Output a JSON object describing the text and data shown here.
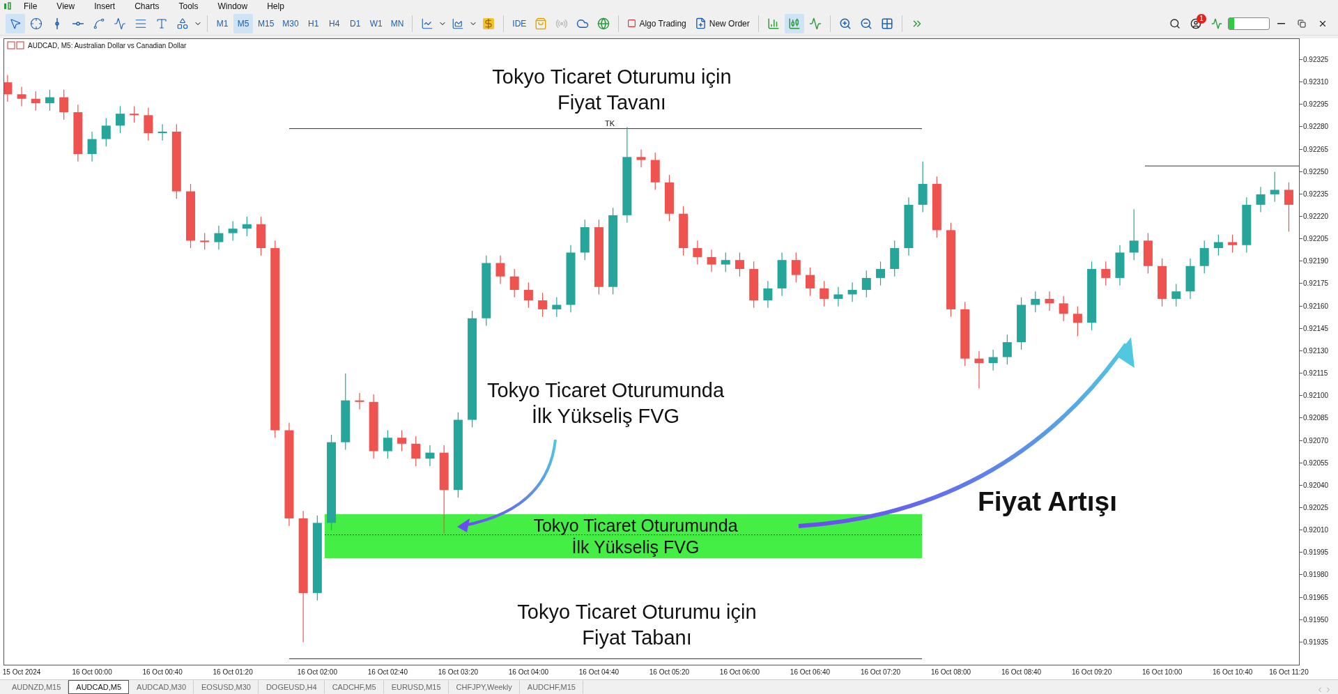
{
  "menu": [
    "File",
    "View",
    "Insert",
    "Charts",
    "Tools",
    "Window",
    "Help"
  ],
  "toolbar": {
    "tools": [
      {
        "kind": "cursor",
        "selected": true
      },
      {
        "kind": "crosshair",
        "selected": false
      },
      {
        "kind": "vline",
        "selected": false
      },
      {
        "kind": "hline",
        "selected": false
      },
      {
        "kind": "trend",
        "selected": false
      },
      {
        "kind": "path",
        "selected": false
      },
      {
        "kind": "channel",
        "selected": false
      },
      {
        "kind": "text",
        "selected": false
      },
      {
        "kind": "shapes",
        "selected": false
      }
    ],
    "timeframes": [
      {
        "label": "M1",
        "selected": false
      },
      {
        "label": "M5",
        "selected": true
      },
      {
        "label": "M15",
        "selected": false
      },
      {
        "label": "M30",
        "selected": false
      },
      {
        "label": "H1",
        "selected": false
      },
      {
        "label": "H4",
        "selected": false
      },
      {
        "label": "D1",
        "selected": false
      },
      {
        "label": "W1",
        "selected": false
      },
      {
        "label": "MN",
        "selected": false
      }
    ],
    "ide_label": "IDE",
    "algo_trading": "Algo Trading",
    "new_order": "New Order",
    "chart_types": [
      {
        "kind": "bars",
        "selected": false
      },
      {
        "kind": "candles",
        "selected": true
      },
      {
        "kind": "line",
        "selected": false
      }
    ],
    "notification_count": "1"
  },
  "chart": {
    "header": "AUDCAD, M5:  Australian Dollar vs Canadian Dollar",
    "level_label": "TK",
    "annotations": [
      {
        "lines": [
          "Tokyo Ticaret Oturumu için",
          "Fiyat Tavanı"
        ]
      },
      {
        "lines": [
          "Tokyo Ticaret Oturumunda",
          "İlk Yükseliş FVG"
        ]
      },
      {
        "lines": [
          "Tokyo Ticaret Oturumu için",
          "Fiyat Tabanı"
        ]
      },
      {
        "lines": [
          "Fiyat Artışı"
        ]
      }
    ],
    "fvg_zone": {
      "lines": [
        "Tokyo Ticaret Oturumunda",
        "İlk Yükseliş FVG"
      ]
    },
    "chart_data": {
      "type": "candlestick",
      "ylim": [
        0.9192,
        0.92339
      ],
      "ref_lines": [
        {
          "axis": "y",
          "value": 0.92279
        },
        {
          "axis": "y",
          "value": 0.92254
        },
        {
          "axis": "y",
          "value": 0.91924
        },
        {
          "axis": "y",
          "value": 0.92007
        }
      ],
      "categories": [
        null,
        "15 Oct 2024",
        null,
        null,
        null,
        null,
        "16 Oct 00:00",
        null,
        null,
        null,
        null,
        "16 Oct 00:40",
        null,
        null,
        null,
        null,
        "16 Oct 01:20",
        null,
        null,
        null,
        null,
        null,
        "16 Oct 02:00",
        null,
        null,
        null,
        null,
        "16 Oct 02:40",
        null,
        null,
        null,
        null,
        "16 Oct 03:20",
        null,
        null,
        null,
        null,
        "16 Oct 04:00",
        null,
        null,
        null,
        null,
        "16 Oct 04:40",
        null,
        null,
        null,
        null,
        "16 Oct 05:20",
        null,
        null,
        null,
        null,
        "16 Oct 06:00",
        null,
        null,
        null,
        null,
        "16 Oct 06:40",
        null,
        null,
        null,
        null,
        "16 Oct 07:20",
        null,
        null,
        null,
        null,
        "16 Oct 08:00",
        null,
        null,
        null,
        null,
        "16 Oct 08:40",
        null,
        null,
        null,
        null,
        "16 Oct 09:20",
        null,
        null,
        null,
        null,
        "16 Oct 10:00",
        null,
        null,
        null,
        null,
        "16 Oct 10:40",
        null,
        null,
        null,
        "16 Oct 11:20"
      ],
      "yticks": [
        {
          "value": 0.92325,
          "label": "0.92325"
        },
        {
          "value": 0.9231,
          "label": "0.92310"
        },
        {
          "value": 0.92295,
          "label": "0.92295"
        },
        {
          "value": 0.9228,
          "label": "0.92280"
        },
        {
          "value": 0.92265,
          "label": "0.92265"
        },
        {
          "value": 0.9225,
          "label": "0.92250"
        },
        {
          "value": 0.92235,
          "label": "0.92235"
        },
        {
          "value": 0.9222,
          "label": "0.92220"
        },
        {
          "value": 0.92205,
          "label": "0.92205"
        },
        {
          "value": 0.9219,
          "label": "0.92190"
        },
        {
          "value": 0.92175,
          "label": "0.92175"
        },
        {
          "value": 0.9216,
          "label": "0.92160"
        },
        {
          "value": 0.92145,
          "label": "0.92145"
        },
        {
          "value": 0.9213,
          "label": "0.92130"
        },
        {
          "value": 0.92115,
          "label": "0.92115"
        },
        {
          "value": 0.921,
          "label": "0.92100"
        },
        {
          "value": 0.92085,
          "label": "0.92085"
        },
        {
          "value": 0.9207,
          "label": "0.92070"
        },
        {
          "value": 0.92055,
          "label": "0.92055"
        },
        {
          "value": 0.9204,
          "label": "0.92040"
        },
        {
          "value": 0.92025,
          "label": "0.92025"
        },
        {
          "value": 0.9201,
          "label": "0.92010"
        },
        {
          "value": 0.91995,
          "label": "0.91995"
        },
        {
          "value": 0.9198,
          "label": "0.91980"
        },
        {
          "value": 0.91965,
          "label": "0.91965"
        },
        {
          "value": 0.9195,
          "label": "0.91950"
        },
        {
          "value": 0.91935,
          "label": "0.91935"
        }
      ],
      "ohlc": [
        [
          0.9231,
          0.92315,
          0.92297,
          0.92302
        ],
        [
          0.92302,
          0.92307,
          0.92294,
          0.92299
        ],
        [
          0.92299,
          0.92304,
          0.92291,
          0.92296
        ],
        [
          0.92296,
          0.92305,
          0.92291,
          0.923
        ],
        [
          0.923,
          0.92305,
          0.92285,
          0.9229
        ],
        [
          0.9229,
          0.92295,
          0.92257,
          0.92262
        ],
        [
          0.92262,
          0.92277,
          0.92257,
          0.92272
        ],
        [
          0.92272,
          0.92286,
          0.92267,
          0.92281
        ],
        [
          0.92281,
          0.92294,
          0.92276,
          0.92289
        ],
        [
          0.92289,
          0.92294,
          0.92283,
          0.92288
        ],
        [
          0.92288,
          0.92293,
          0.92271,
          0.92276
        ],
        [
          0.92276,
          0.92282,
          0.92271,
          0.92277
        ],
        [
          0.92277,
          0.92282,
          0.92232,
          0.92237
        ],
        [
          0.92237,
          0.92242,
          0.92199,
          0.92204
        ],
        [
          0.92204,
          0.92209,
          0.92198,
          0.92203
        ],
        [
          0.92203,
          0.92214,
          0.92198,
          0.92209
        ],
        [
          0.92209,
          0.92217,
          0.92204,
          0.92212
        ],
        [
          0.92212,
          0.9222,
          0.92207,
          0.92215
        ],
        [
          0.92215,
          0.9222,
          0.92194,
          0.92199
        ],
        [
          0.92199,
          0.92204,
          0.92072,
          0.92077
        ],
        [
          0.92077,
          0.92082,
          0.92013,
          0.92018
        ],
        [
          0.92018,
          0.92023,
          0.91935,
          0.91968
        ],
        [
          0.91968,
          0.9202,
          0.91963,
          0.92015
        ],
        [
          0.92015,
          0.92074,
          0.9201,
          0.92069
        ],
        [
          0.92069,
          0.92115,
          0.92064,
          0.92097
        ],
        [
          0.92097,
          0.92102,
          0.92091,
          0.92096
        ],
        [
          0.92096,
          0.92101,
          0.92058,
          0.92063
        ],
        [
          0.92063,
          0.92077,
          0.92058,
          0.92072
        ],
        [
          0.92072,
          0.92077,
          0.92063,
          0.92068
        ],
        [
          0.92068,
          0.92073,
          0.92053,
          0.92058
        ],
        [
          0.92058,
          0.92067,
          0.92053,
          0.92062
        ],
        [
          0.92062,
          0.92067,
          0.92008,
          0.92037
        ],
        [
          0.92037,
          0.92089,
          0.92032,
          0.92084
        ],
        [
          0.92084,
          0.92157,
          0.92079,
          0.92152
        ],
        [
          0.92152,
          0.92194,
          0.92147,
          0.92189
        ],
        [
          0.92189,
          0.92194,
          0.92175,
          0.9218
        ],
        [
          0.9218,
          0.92185,
          0.92166,
          0.92171
        ],
        [
          0.92171,
          0.92176,
          0.92159,
          0.92164
        ],
        [
          0.92164,
          0.92169,
          0.92153,
          0.92158
        ],
        [
          0.92158,
          0.92166,
          0.92153,
          0.92161
        ],
        [
          0.92161,
          0.92201,
          0.92156,
          0.92196
        ],
        [
          0.92196,
          0.92218,
          0.92191,
          0.92213
        ],
        [
          0.92213,
          0.92218,
          0.92168,
          0.92173
        ],
        [
          0.92173,
          0.92226,
          0.92168,
          0.92221
        ],
        [
          0.92221,
          0.9228,
          0.92216,
          0.9226
        ],
        [
          0.9226,
          0.92265,
          0.92253,
          0.92258
        ],
        [
          0.92258,
          0.92263,
          0.92238,
          0.92243
        ],
        [
          0.92243,
          0.92248,
          0.92217,
          0.92222
        ],
        [
          0.92222,
          0.92227,
          0.92194,
          0.92199
        ],
        [
          0.92199,
          0.92204,
          0.92188,
          0.92193
        ],
        [
          0.92193,
          0.92198,
          0.92183,
          0.92188
        ],
        [
          0.92188,
          0.92196,
          0.92183,
          0.92191
        ],
        [
          0.92191,
          0.92196,
          0.9218,
          0.92185
        ],
        [
          0.92185,
          0.9219,
          0.92159,
          0.92164
        ],
        [
          0.92164,
          0.92177,
          0.92159,
          0.92172
        ],
        [
          0.92172,
          0.92196,
          0.92167,
          0.92191
        ],
        [
          0.92191,
          0.92196,
          0.92176,
          0.92181
        ],
        [
          0.92181,
          0.92186,
          0.92167,
          0.92172
        ],
        [
          0.92172,
          0.92177,
          0.9216,
          0.92165
        ],
        [
          0.92165,
          0.92173,
          0.9216,
          0.92168
        ],
        [
          0.92168,
          0.92176,
          0.92163,
          0.92171
        ],
        [
          0.92171,
          0.92184,
          0.92166,
          0.92179
        ],
        [
          0.92179,
          0.9219,
          0.92174,
          0.92185
        ],
        [
          0.92185,
          0.92204,
          0.9218,
          0.92199
        ],
        [
          0.92199,
          0.92233,
          0.92194,
          0.92228
        ],
        [
          0.92228,
          0.92257,
          0.92223,
          0.92242
        ],
        [
          0.92242,
          0.92247,
          0.92206,
          0.92211
        ],
        [
          0.92211,
          0.92216,
          0.92153,
          0.92158
        ],
        [
          0.92158,
          0.92163,
          0.9212,
          0.92125
        ],
        [
          0.92125,
          0.9213,
          0.92105,
          0.92122
        ],
        [
          0.92122,
          0.92131,
          0.92117,
          0.92126
        ],
        [
          0.92126,
          0.92141,
          0.92121,
          0.92136
        ],
        [
          0.92136,
          0.92166,
          0.92131,
          0.92161
        ],
        [
          0.92161,
          0.9217,
          0.92156,
          0.92165
        ],
        [
          0.92165,
          0.9217,
          0.92157,
          0.92162
        ],
        [
          0.92162,
          0.92167,
          0.9215,
          0.92155
        ],
        [
          0.92155,
          0.9216,
          0.9214,
          0.92149
        ],
        [
          0.92149,
          0.9219,
          0.92144,
          0.92185
        ],
        [
          0.92185,
          0.9219,
          0.92174,
          0.92179
        ],
        [
          0.92179,
          0.92201,
          0.92174,
          0.92196
        ],
        [
          0.92196,
          0.92225,
          0.92191,
          0.92204
        ],
        [
          0.92204,
          0.92209,
          0.92182,
          0.92187
        ],
        [
          0.92187,
          0.92192,
          0.9216,
          0.92165
        ],
        [
          0.92165,
          0.92175,
          0.9216,
          0.9217
        ],
        [
          0.9217,
          0.92192,
          0.92165,
          0.92187
        ],
        [
          0.92187,
          0.92204,
          0.92182,
          0.92199
        ],
        [
          0.92199,
          0.92208,
          0.92194,
          0.92203
        ],
        [
          0.92203,
          0.92208,
          0.92196,
          0.92201
        ],
        [
          0.92201,
          0.92233,
          0.92196,
          0.92228
        ],
        [
          0.92228,
          0.9224,
          0.92223,
          0.92235
        ],
        [
          0.92235,
          0.9225,
          0.9223,
          0.92238
        ],
        [
          0.92238,
          0.92243,
          0.9221,
          0.92228
        ]
      ]
    }
  },
  "tabs": [
    {
      "label": "AUDNZD,M15",
      "selected": false
    },
    {
      "label": "AUDCAD,M5",
      "selected": true
    },
    {
      "label": "AUDCAD,M30",
      "selected": false
    },
    {
      "label": "EOSUSD,M30",
      "selected": false
    },
    {
      "label": "DOGEUSD,H4",
      "selected": false
    },
    {
      "label": "CADCHF,M5",
      "selected": false
    },
    {
      "label": "EURUSD,M15",
      "selected": false
    },
    {
      "label": "CHFJPY,Weekly",
      "selected": false
    },
    {
      "label": "AUDCHF,M15",
      "selected": false
    }
  ]
}
